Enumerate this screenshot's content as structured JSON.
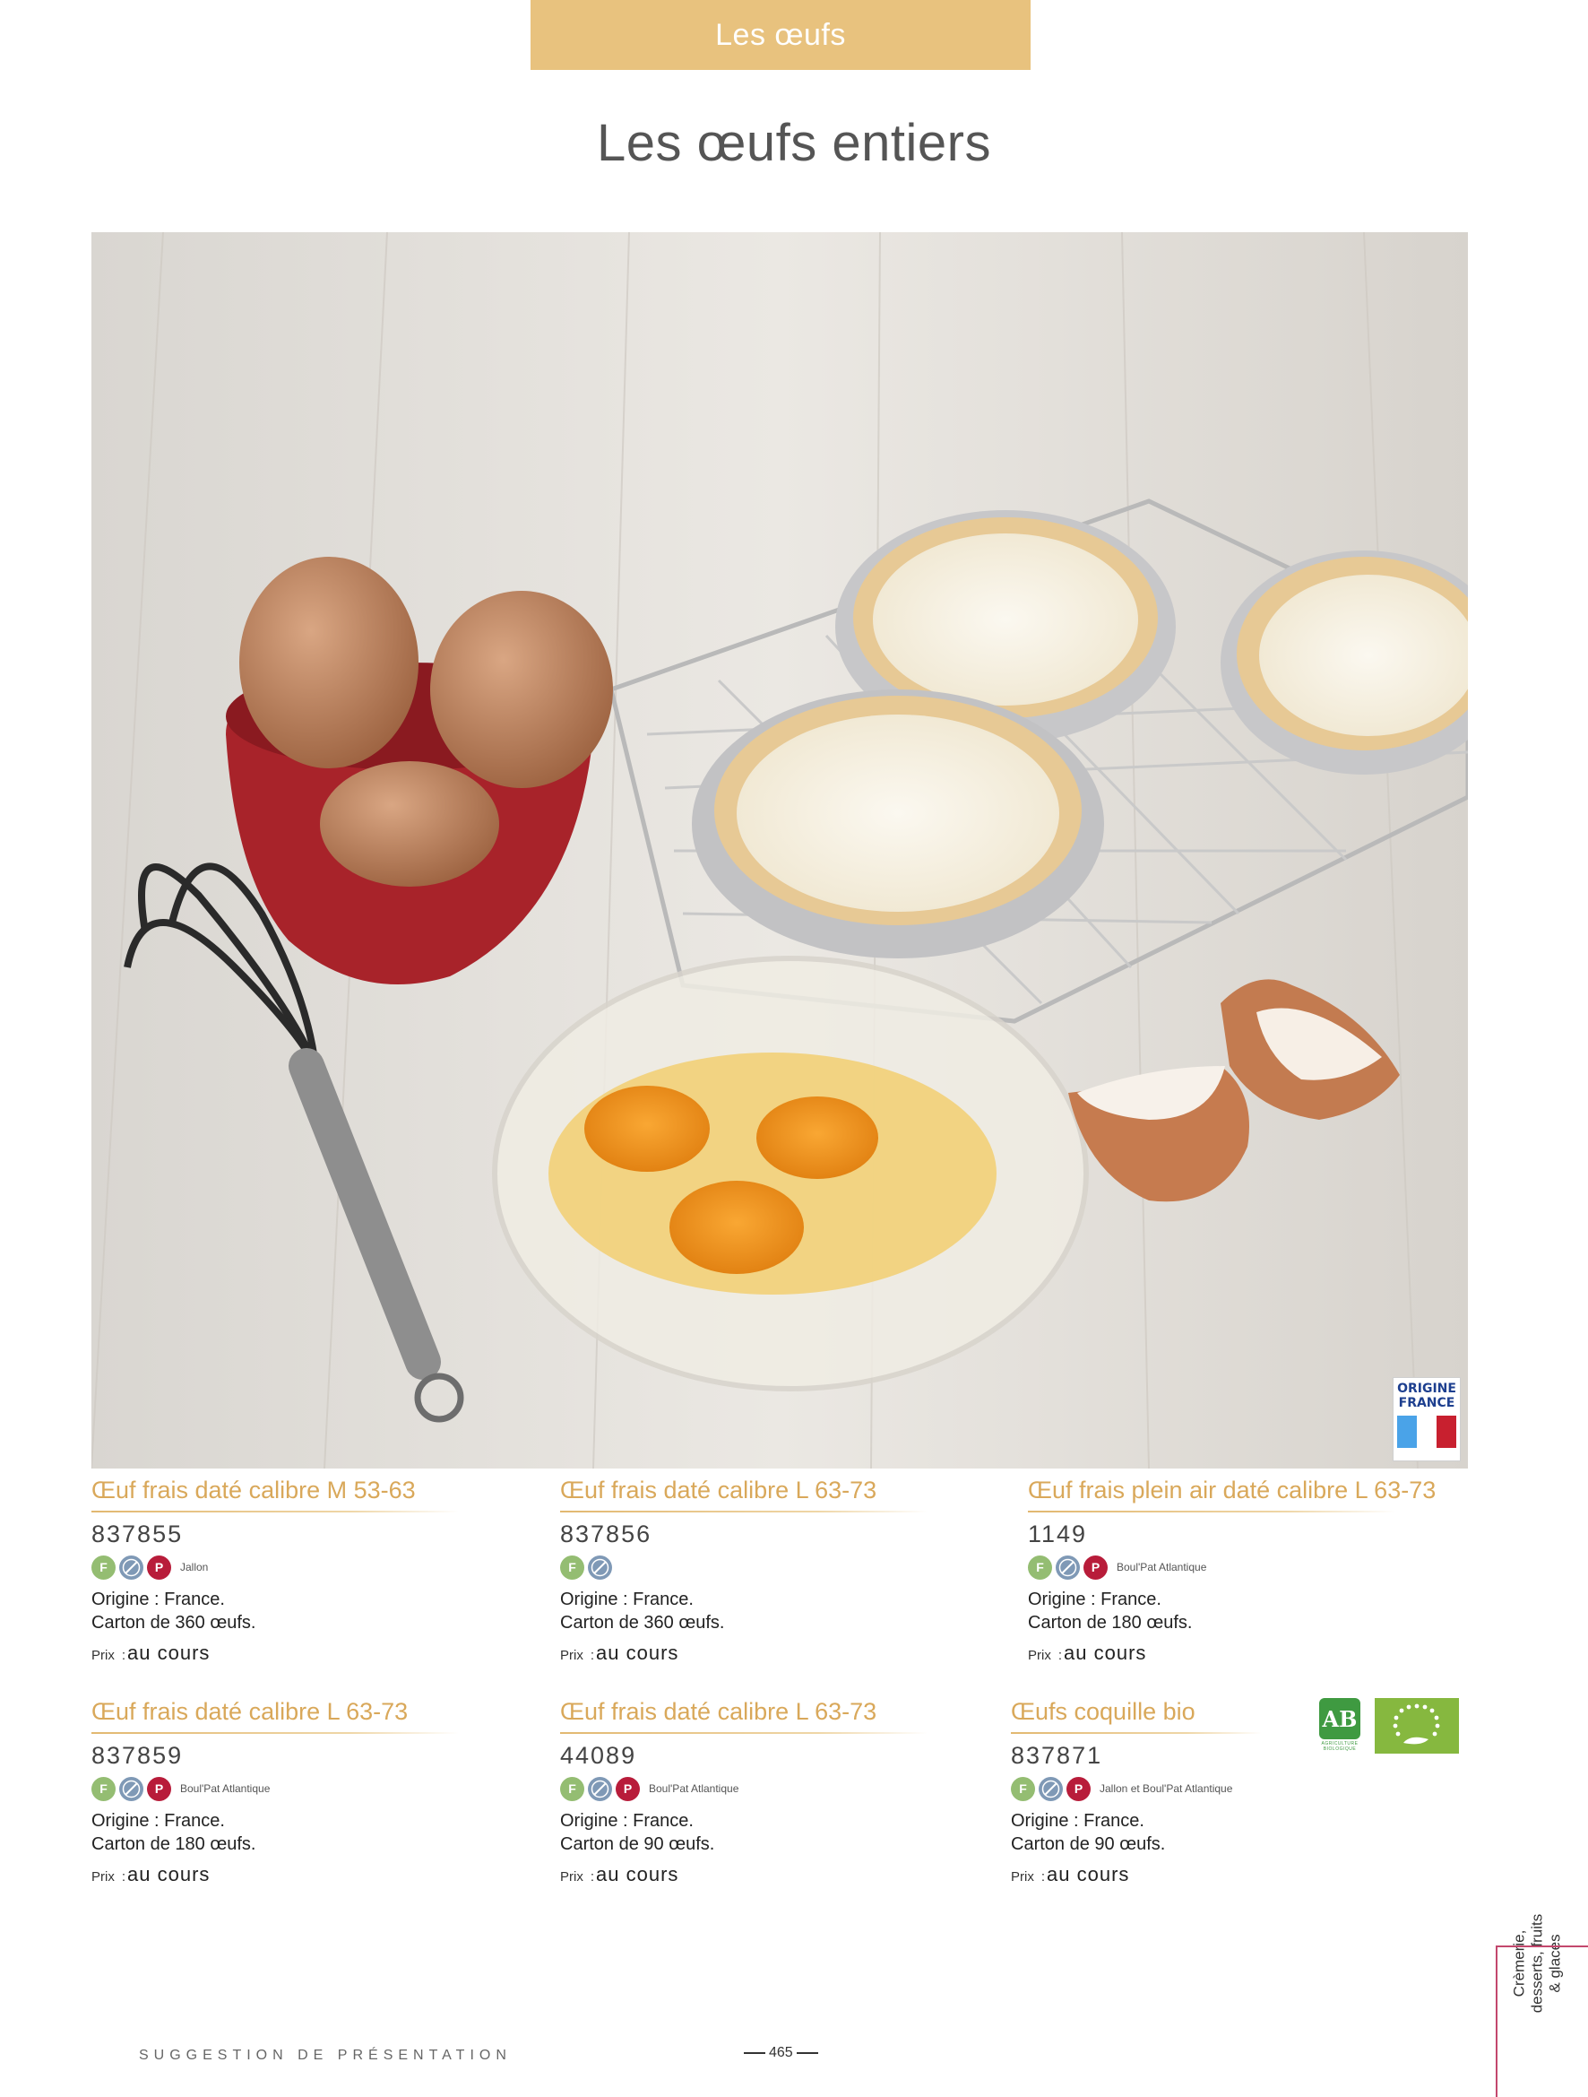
{
  "header": {
    "section": "Les œufs",
    "title": "Les œufs entiers"
  },
  "photo": {
    "badge_text": "ORIGINE\nFRANCE",
    "flag_colors": [
      "#4aa3e8",
      "#ffffff",
      "#c8202f"
    ]
  },
  "colors": {
    "accent": "#e8c27e",
    "product_title": "#d9a85a",
    "side_accent": "#c3476d"
  },
  "products": [
    {
      "name": "Œuf frais daté calibre M 53-63",
      "code": "837855",
      "icons": [
        "F",
        "cage-icon",
        "P"
      ],
      "supplier": "Jallon",
      "origin": "Origine : France.",
      "carton": "Carton de 360 œufs.",
      "price_label": "Prix",
      "price_sep": ":",
      "price_value": "au cours"
    },
    {
      "name": "Œuf frais daté calibre L 63-73",
      "code": "837856",
      "icons": [
        "F",
        "cage-icon"
      ],
      "supplier": "",
      "origin": "Origine : France.",
      "carton": "Carton de 360 œufs.",
      "price_label": "Prix",
      "price_sep": ":",
      "price_value": "au cours"
    },
    {
      "name": "Œuf frais plein air daté calibre L 63-73",
      "code": "1149",
      "icons": [
        "F",
        "cage-icon",
        "P"
      ],
      "supplier": "Boul'Pat Atlantique",
      "origin": "Origine : France.",
      "carton": "Carton de 180 œufs.",
      "price_label": "Prix",
      "price_sep": ":",
      "price_value": "au cours"
    },
    {
      "name": "Œuf frais daté calibre L 63-73",
      "code": "837859",
      "icons": [
        "F",
        "cage-icon",
        "P"
      ],
      "supplier": "Boul'Pat Atlantique",
      "origin": "Origine : France.",
      "carton": "Carton de 180 œufs.",
      "price_label": "Prix",
      "price_sep": ":",
      "price_value": "au cours"
    },
    {
      "name": "Œuf frais daté calibre L 63-73",
      "code": "44089",
      "icons": [
        "F",
        "cage-icon",
        "P"
      ],
      "supplier": "Boul'Pat Atlantique",
      "origin": "Origine : France.",
      "carton": "Carton de 90 œufs.",
      "price_label": "Prix",
      "price_sep": ":",
      "price_value": "au cours"
    },
    {
      "name": "Œufs coquille bio",
      "code": "837871",
      "icons": [
        "F",
        "cage-icon",
        "P"
      ],
      "supplier": "Jallon et Boul'Pat Atlantique",
      "origin": "Origine : France.",
      "carton": "Carton de 90 œufs.",
      "price_label": "Prix",
      "price_sep": ":",
      "price_value": "au cours"
    }
  ],
  "bio_logos": {
    "ab_mark": "AB",
    "ab_subtitle": "AGRICULTURE BIOLOGIQUE"
  },
  "side_tab": {
    "line1": "Crèmerie,",
    "line2": "desserts, fruits",
    "line3": "& glaces"
  },
  "footer": {
    "note": "SUGGESTION DE PRÉSENTATION",
    "page_number": "465"
  }
}
